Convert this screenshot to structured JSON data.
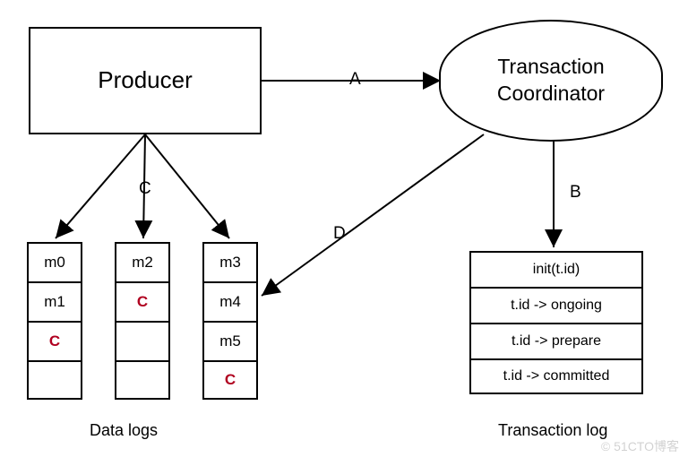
{
  "nodes": {
    "producer": "Producer",
    "coordinator": "Transaction\nCoordinator"
  },
  "edges": {
    "A": "A",
    "B": "B",
    "C": "C",
    "D": "D"
  },
  "data_logs": {
    "caption": "Data logs",
    "columns": [
      [
        "m0",
        "m1",
        "C",
        ""
      ],
      [
        "m2",
        "C",
        "",
        ""
      ],
      [
        "m3",
        "m4",
        "m5",
        "C"
      ]
    ],
    "commit_marker": "C"
  },
  "transaction_log": {
    "caption": "Transaction log",
    "entries": [
      "init(t.id)",
      "t.id -> ongoing",
      "t.id -> prepare",
      "t.id -> committed"
    ]
  },
  "watermark": "© 51CTO博客"
}
